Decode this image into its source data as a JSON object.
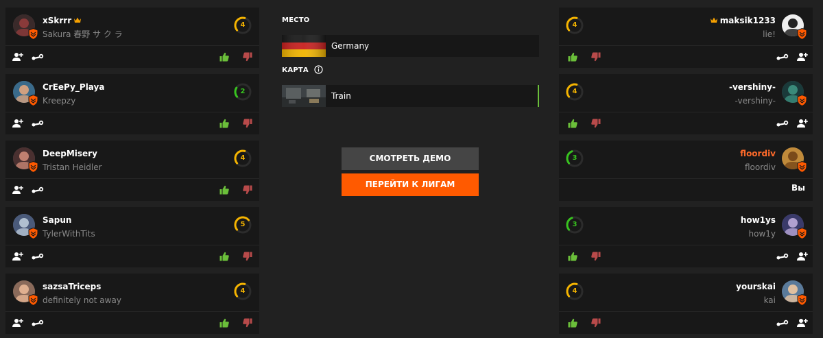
{
  "colors": {
    "background": "#212121",
    "card": "#181818",
    "accent": "#ff5a00",
    "like": "#6bbf3a",
    "dislike": "#b84a4a",
    "level_yellow": "#f5b400",
    "level_green": "#38c41f",
    "self_nick": "#ff6a2a"
  },
  "team_left": [
    {
      "nick": "xSkrrr",
      "crown": true,
      "sub": "Sakura 春野 サ ク ラ",
      "level": "4",
      "level_color": "yellow",
      "level_fraction": 0.4
    },
    {
      "nick": "CrEePy_Playa",
      "crown": false,
      "sub": "Kreepzy",
      "level": "2",
      "level_color": "green",
      "level_fraction": 0.2
    },
    {
      "nick": "DeepMisery",
      "crown": false,
      "sub": "Tristan Heidler",
      "level": "4",
      "level_color": "yellow",
      "level_fraction": 0.4
    },
    {
      "nick": "Sapun",
      "crown": false,
      "sub": "TylerWithTits",
      "level": "5",
      "level_color": "yellow",
      "level_fraction": 0.5
    },
    {
      "nick": "sazsaTriceps",
      "crown": false,
      "sub": "definitely not away",
      "level": "4",
      "level_color": "yellow",
      "level_fraction": 0.4
    }
  ],
  "team_right": [
    {
      "nick": "maksik1233",
      "crown": true,
      "sub": "lie!",
      "level": "4",
      "level_color": "yellow",
      "level_fraction": 0.4
    },
    {
      "nick": "-vershiny-",
      "crown": false,
      "sub": "-vershiny-",
      "level": "4",
      "level_color": "yellow",
      "level_fraction": 0.4
    },
    {
      "nick": "floordiv",
      "crown": false,
      "sub": "floordiv",
      "level": "3",
      "level_color": "green",
      "level_fraction": 0.3,
      "is_you": true,
      "you_label": "Вы"
    },
    {
      "nick": "how1ys",
      "crown": false,
      "sub": "how1y",
      "level": "3",
      "level_color": "green",
      "level_fraction": 0.3
    },
    {
      "nick": "yourskai",
      "crown": false,
      "sub": "kai",
      "level": "4",
      "level_color": "yellow",
      "level_fraction": 0.4
    }
  ],
  "match": {
    "location_label": "МЕСТО",
    "location": "Germany",
    "map_label": "КАРТА",
    "map": "Train"
  },
  "buttons": {
    "demo": "СМОТРЕТЬ ДЕМО",
    "leagues": "ПЕРЕЙТИ К ЛИГАМ"
  },
  "icons": {
    "add_friend": "add-friend-icon",
    "steam": "steam-icon",
    "like": "thumbs-up-icon",
    "dislike": "thumbs-down-icon",
    "info": "info-icon",
    "crown": "crown-icon",
    "shield": "shield-icon"
  }
}
